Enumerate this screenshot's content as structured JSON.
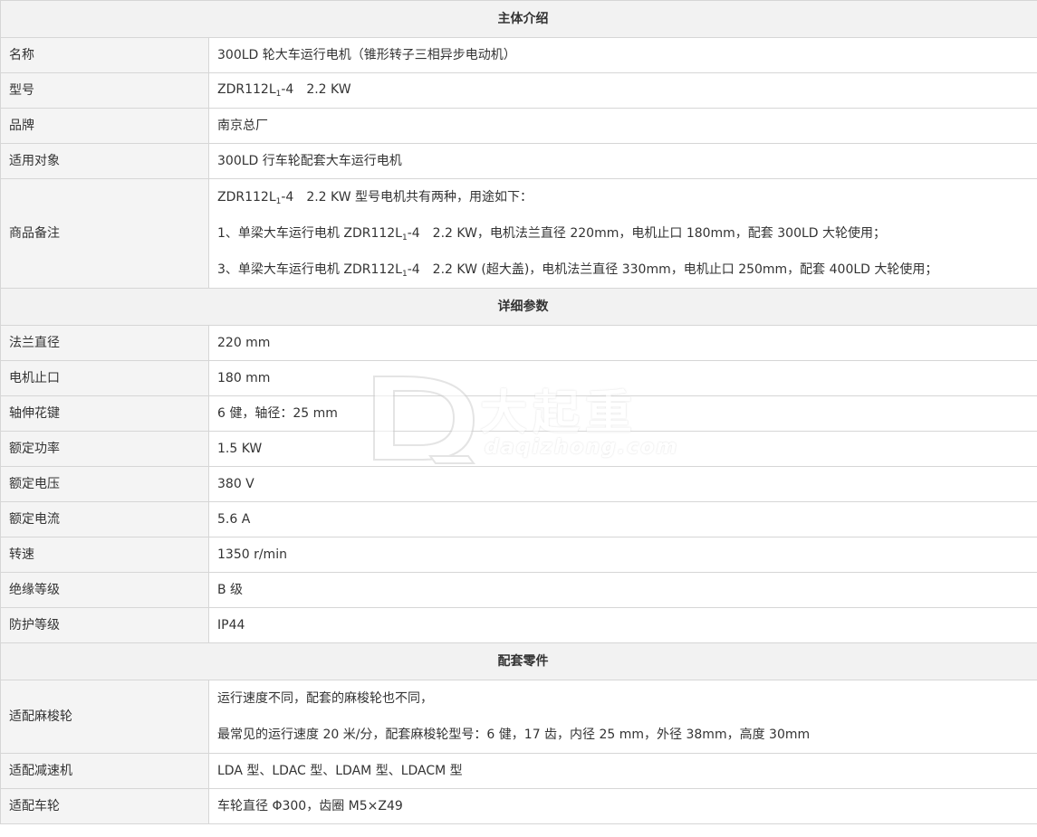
{
  "sections": {
    "intro": "主体介绍",
    "params": "详细参数",
    "parts": "配套零件"
  },
  "intro_rows": {
    "name": {
      "label": "名称",
      "value": "300LD 轮大车运行电机（锥形转子三相异步电动机）"
    },
    "model": {
      "label": "型号",
      "value_pre": "ZDR112L",
      "value_sub": "1",
      "value_post": "-4　2.2 KW"
    },
    "brand": {
      "label": "品牌",
      "value": "南京总厂"
    },
    "target": {
      "label": "适用对象",
      "value": "300LD 行车轮配套大车运行电机"
    },
    "remarks": {
      "label": "商品备注",
      "line1_pre": "ZDR112L",
      "line1_sub": "1",
      "line1_post": "-4　2.2 KW 型号电机共有两种，用途如下：",
      "line2_pre": "1、单梁大车运行电机 ZDR112L",
      "line2_sub": "1",
      "line2_post": "-4　2.2 KW，电机法兰直径 220mm，电机止口 180mm，配套 300LD 大轮使用；",
      "line3_pre": "3、单梁大车运行电机 ZDR112L",
      "line3_sub": "1",
      "line3_post": "-4　2.2 KW (超大盖)，电机法兰直径 330mm，电机止口 250mm，配套 400LD 大轮使用；"
    }
  },
  "param_rows": [
    {
      "label": "法兰直径",
      "value": "220 mm"
    },
    {
      "label": "电机止口",
      "value": "180 mm"
    },
    {
      "label": "轴伸花键",
      "value": "6 健，轴径：25 mm"
    },
    {
      "label": "额定功率",
      "value": "1.5 KW"
    },
    {
      "label": "额定电压",
      "value": "380 V"
    },
    {
      "label": "额定电流",
      "value": "5.6 A"
    },
    {
      "label": "转速",
      "value": "1350 r/min"
    },
    {
      "label": "绝缘等级",
      "value": "B 级"
    },
    {
      "label": "防护等级",
      "value": "IP44"
    }
  ],
  "parts_rows": {
    "rope_wheel": {
      "label": "适配麻梭轮",
      "line1": "运行速度不同，配套的麻梭轮也不同，",
      "line2": "最常见的运行速度 20 米/分，配套麻梭轮型号：6 健，17 齿，内径 25 mm，外径 38mm，高度 30mm"
    },
    "reducer": {
      "label": "适配减速机",
      "value": "LDA 型、LDAC 型、LDAM 型、LDACM 型"
    },
    "wheel": {
      "label": "适配车轮",
      "value": "车轮直径 Φ300，齿圈 M5×Z49"
    }
  },
  "watermark": {
    "cn": "大起重",
    "en": "daqizhong.com"
  }
}
